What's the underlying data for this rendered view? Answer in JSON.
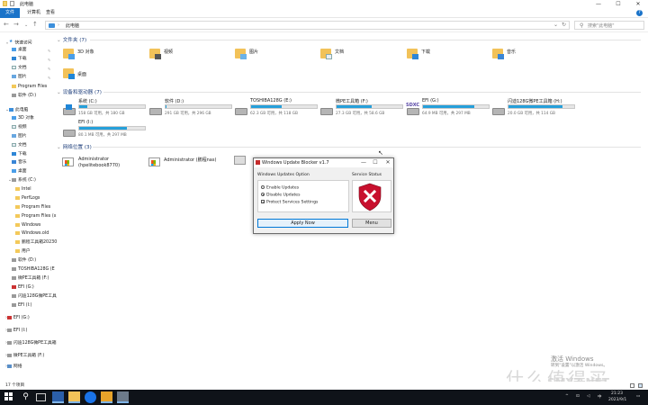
{
  "window": {
    "title": "此电脑",
    "controls": {
      "minimize": "—",
      "maximize": "☐",
      "close": "✕"
    }
  },
  "ribbon": {
    "tabs": [
      "文件",
      "计算机",
      "查看"
    ]
  },
  "address": {
    "path": "此电脑",
    "search_placeholder": "搜索\"此电脑\""
  },
  "sidebar": {
    "items": [
      {
        "label": "快速访问",
        "icon": "star-icon"
      },
      {
        "label": "桌面",
        "icon": "desktop-icon"
      },
      {
        "label": "下载",
        "icon": "download-icon"
      },
      {
        "label": "文档",
        "icon": "document-icon"
      },
      {
        "label": "图片",
        "icon": "picture-icon"
      },
      {
        "label": "Program Files",
        "icon": "folder-icon"
      },
      {
        "label": "软件 (D:)",
        "icon": "drive-icon"
      },
      {
        "label": "此电脑",
        "icon": "computer-icon"
      },
      {
        "label": "3D 对象",
        "icon": "3d-object-icon"
      },
      {
        "label": "视频",
        "icon": "video-icon"
      },
      {
        "label": "图片",
        "icon": "picture-icon"
      },
      {
        "label": "文档",
        "icon": "document-icon"
      },
      {
        "label": "下载",
        "icon": "download-icon"
      },
      {
        "label": "音乐",
        "icon": "music-icon"
      },
      {
        "label": "桌面",
        "icon": "desktop-icon"
      },
      {
        "label": "系统 (C:)",
        "icon": "drive-icon"
      },
      {
        "label": "Intel",
        "icon": "folder-icon"
      },
      {
        "label": "PerfLogs",
        "icon": "folder-icon"
      },
      {
        "label": "Program Files",
        "icon": "folder-icon"
      },
      {
        "label": "Program Files (x",
        "icon": "folder-icon"
      },
      {
        "label": "Windows",
        "icon": "folder-icon"
      },
      {
        "label": "Windows.old",
        "icon": "folder-icon"
      },
      {
        "label": "鹏程工具箱20230",
        "icon": "folder-icon"
      },
      {
        "label": "用户",
        "icon": "folder-icon"
      },
      {
        "label": "软件 (D:)",
        "icon": "drive-icon"
      },
      {
        "label": "TOSHIBA128G (E",
        "icon": "drive-icon"
      },
      {
        "label": "微PE工具箱 (F:)",
        "icon": "drive-icon"
      },
      {
        "label": "EFI (G:)",
        "icon": "efi-icon"
      },
      {
        "label": "闪迪128G微PE工具",
        "icon": "drive-icon"
      },
      {
        "label": "EFI (I:)",
        "icon": "drive-icon"
      },
      {
        "label": "EFI (G:)",
        "icon": "efi-icon"
      },
      {
        "label": "EFI (I:)",
        "icon": "drive-icon"
      },
      {
        "label": "闪迪128G微PE工具箱",
        "icon": "drive-icon"
      },
      {
        "label": "微PE工具箱 (F:)",
        "icon": "drive-icon"
      },
      {
        "label": "网络",
        "icon": "network-icon"
      }
    ]
  },
  "sections": {
    "folders_title": "文件夹 (7)",
    "devices_title": "设备和驱动器 (7)",
    "network_title": "网络位置 (3)"
  },
  "folders": [
    {
      "label": "3D 对象",
      "icon": "3d-object-icon"
    },
    {
      "label": "视频",
      "icon": "video-icon"
    },
    {
      "label": "图片",
      "icon": "picture-icon"
    },
    {
      "label": "文档",
      "icon": "document-icon"
    },
    {
      "label": "下载",
      "icon": "download-icon"
    },
    {
      "label": "音乐",
      "icon": "music-icon"
    },
    {
      "label": "桌面",
      "icon": "desktop-icon"
    }
  ],
  "drives": [
    {
      "name": "系统 (C:)",
      "info": "158 GB 可用，共 180 GB",
      "used_fraction": 0.12,
      "icon": "system-drive-icon"
    },
    {
      "name": "软件 (D:)",
      "info": "291 GB 可用，共 296 GB",
      "used_fraction": 0.02,
      "icon": "drive-icon"
    },
    {
      "name": "TOSHIBA128G (E:)",
      "info": "62.3 GB 可用，共 118 GB",
      "used_fraction": 0.47,
      "icon": "drive-icon"
    },
    {
      "name": "微PE工具箱 (F:)",
      "info": "27.3 GB 可用，共 58.6 GB",
      "used_fraction": 0.53,
      "icon": "drive-icon"
    },
    {
      "name": "EFI (G:)",
      "info": "64.9 MB 可用，共 297 MB",
      "used_fraction": 0.78,
      "icon": "sdxc-icon"
    },
    {
      "name": "闪迪128G微PE工具箱 (H:)",
      "info": "20.0 GB 可用，共 114 GB",
      "used_fraction": 0.82,
      "icon": "drive-icon"
    },
    {
      "name": "EFI (I:)",
      "info": "80.1 MB 可用，共 297 MB",
      "used_fraction": 0.73,
      "icon": "drive-icon"
    }
  ],
  "network": [
    {
      "line1": "Administrator",
      "line2": "(hpelitebook8770)",
      "icon": "network-computer-icon"
    },
    {
      "line1": "Administrator (鹏程nas)",
      "line2": "",
      "icon": "network-computer-icon"
    }
  ],
  "dialog": {
    "title": "Windows Update Blocker v1.7",
    "options_title": "Windows Updates Option",
    "status_title": "Service Status",
    "enable_label": "Enable Updates",
    "disable_label": "Disable Updates",
    "protect_label": "Protect Services Settings",
    "selected": "disable",
    "protect_checked": true,
    "apply_label": "Apply Now",
    "menu_label": "Menu",
    "status_icon": "shield-x-icon",
    "status_color": "#c8102e"
  },
  "statusbar": {
    "count": "17 个项目"
  },
  "watermark": {
    "activate_title": "激活 Windows",
    "activate_sub": "转到\"设置\"以激活 Windows。",
    "site": "SMYZ.NET",
    "site_cn": "什么值得买"
  },
  "taskbar": {
    "time": "21:23",
    "date": "2023/9/1",
    "lang": "中"
  }
}
